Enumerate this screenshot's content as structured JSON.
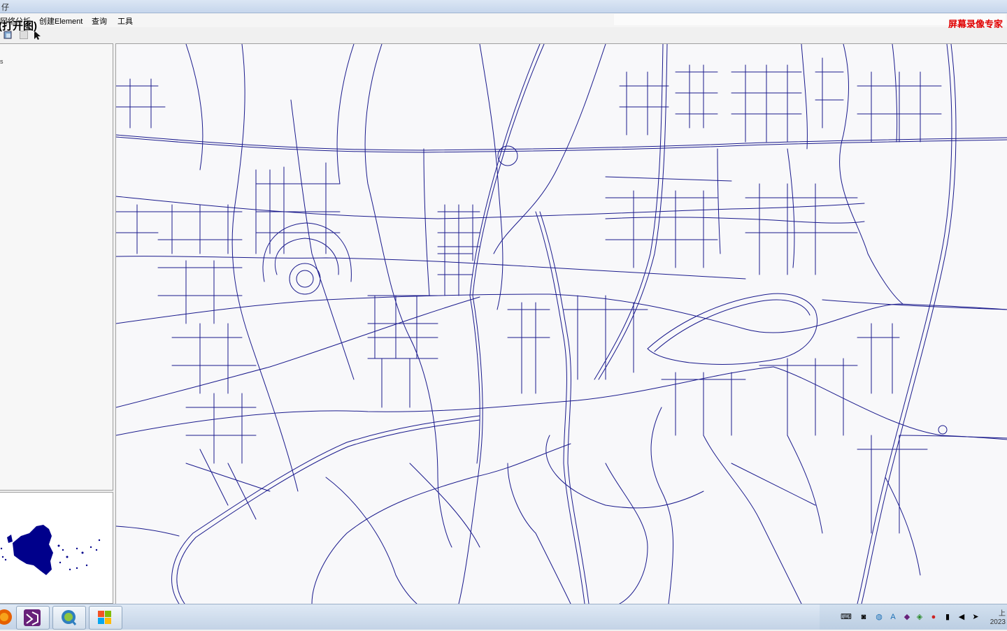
{
  "window": {
    "title_fragment": "仔"
  },
  "menu": {
    "items": [
      {
        "label": "网络分析"
      },
      {
        "label": "创建Element"
      },
      {
        "label": "查询"
      },
      {
        "label": "工具"
      }
    ]
  },
  "overlay_label": "(打开图)",
  "recorder_watermark": "屏幕录像专家",
  "left_panel": {
    "layer_item": "s"
  },
  "taskbar": {
    "apps": [
      "firefox-icon",
      "visual-studio-icon",
      "qgis-icon",
      "windows-explorer-icon"
    ],
    "clock": {
      "line1": "上",
      "line2": "2023"
    }
  },
  "colors": {
    "road": "#1a1a8c",
    "overview_blob": "#00008b",
    "recorder": "#e00000"
  }
}
